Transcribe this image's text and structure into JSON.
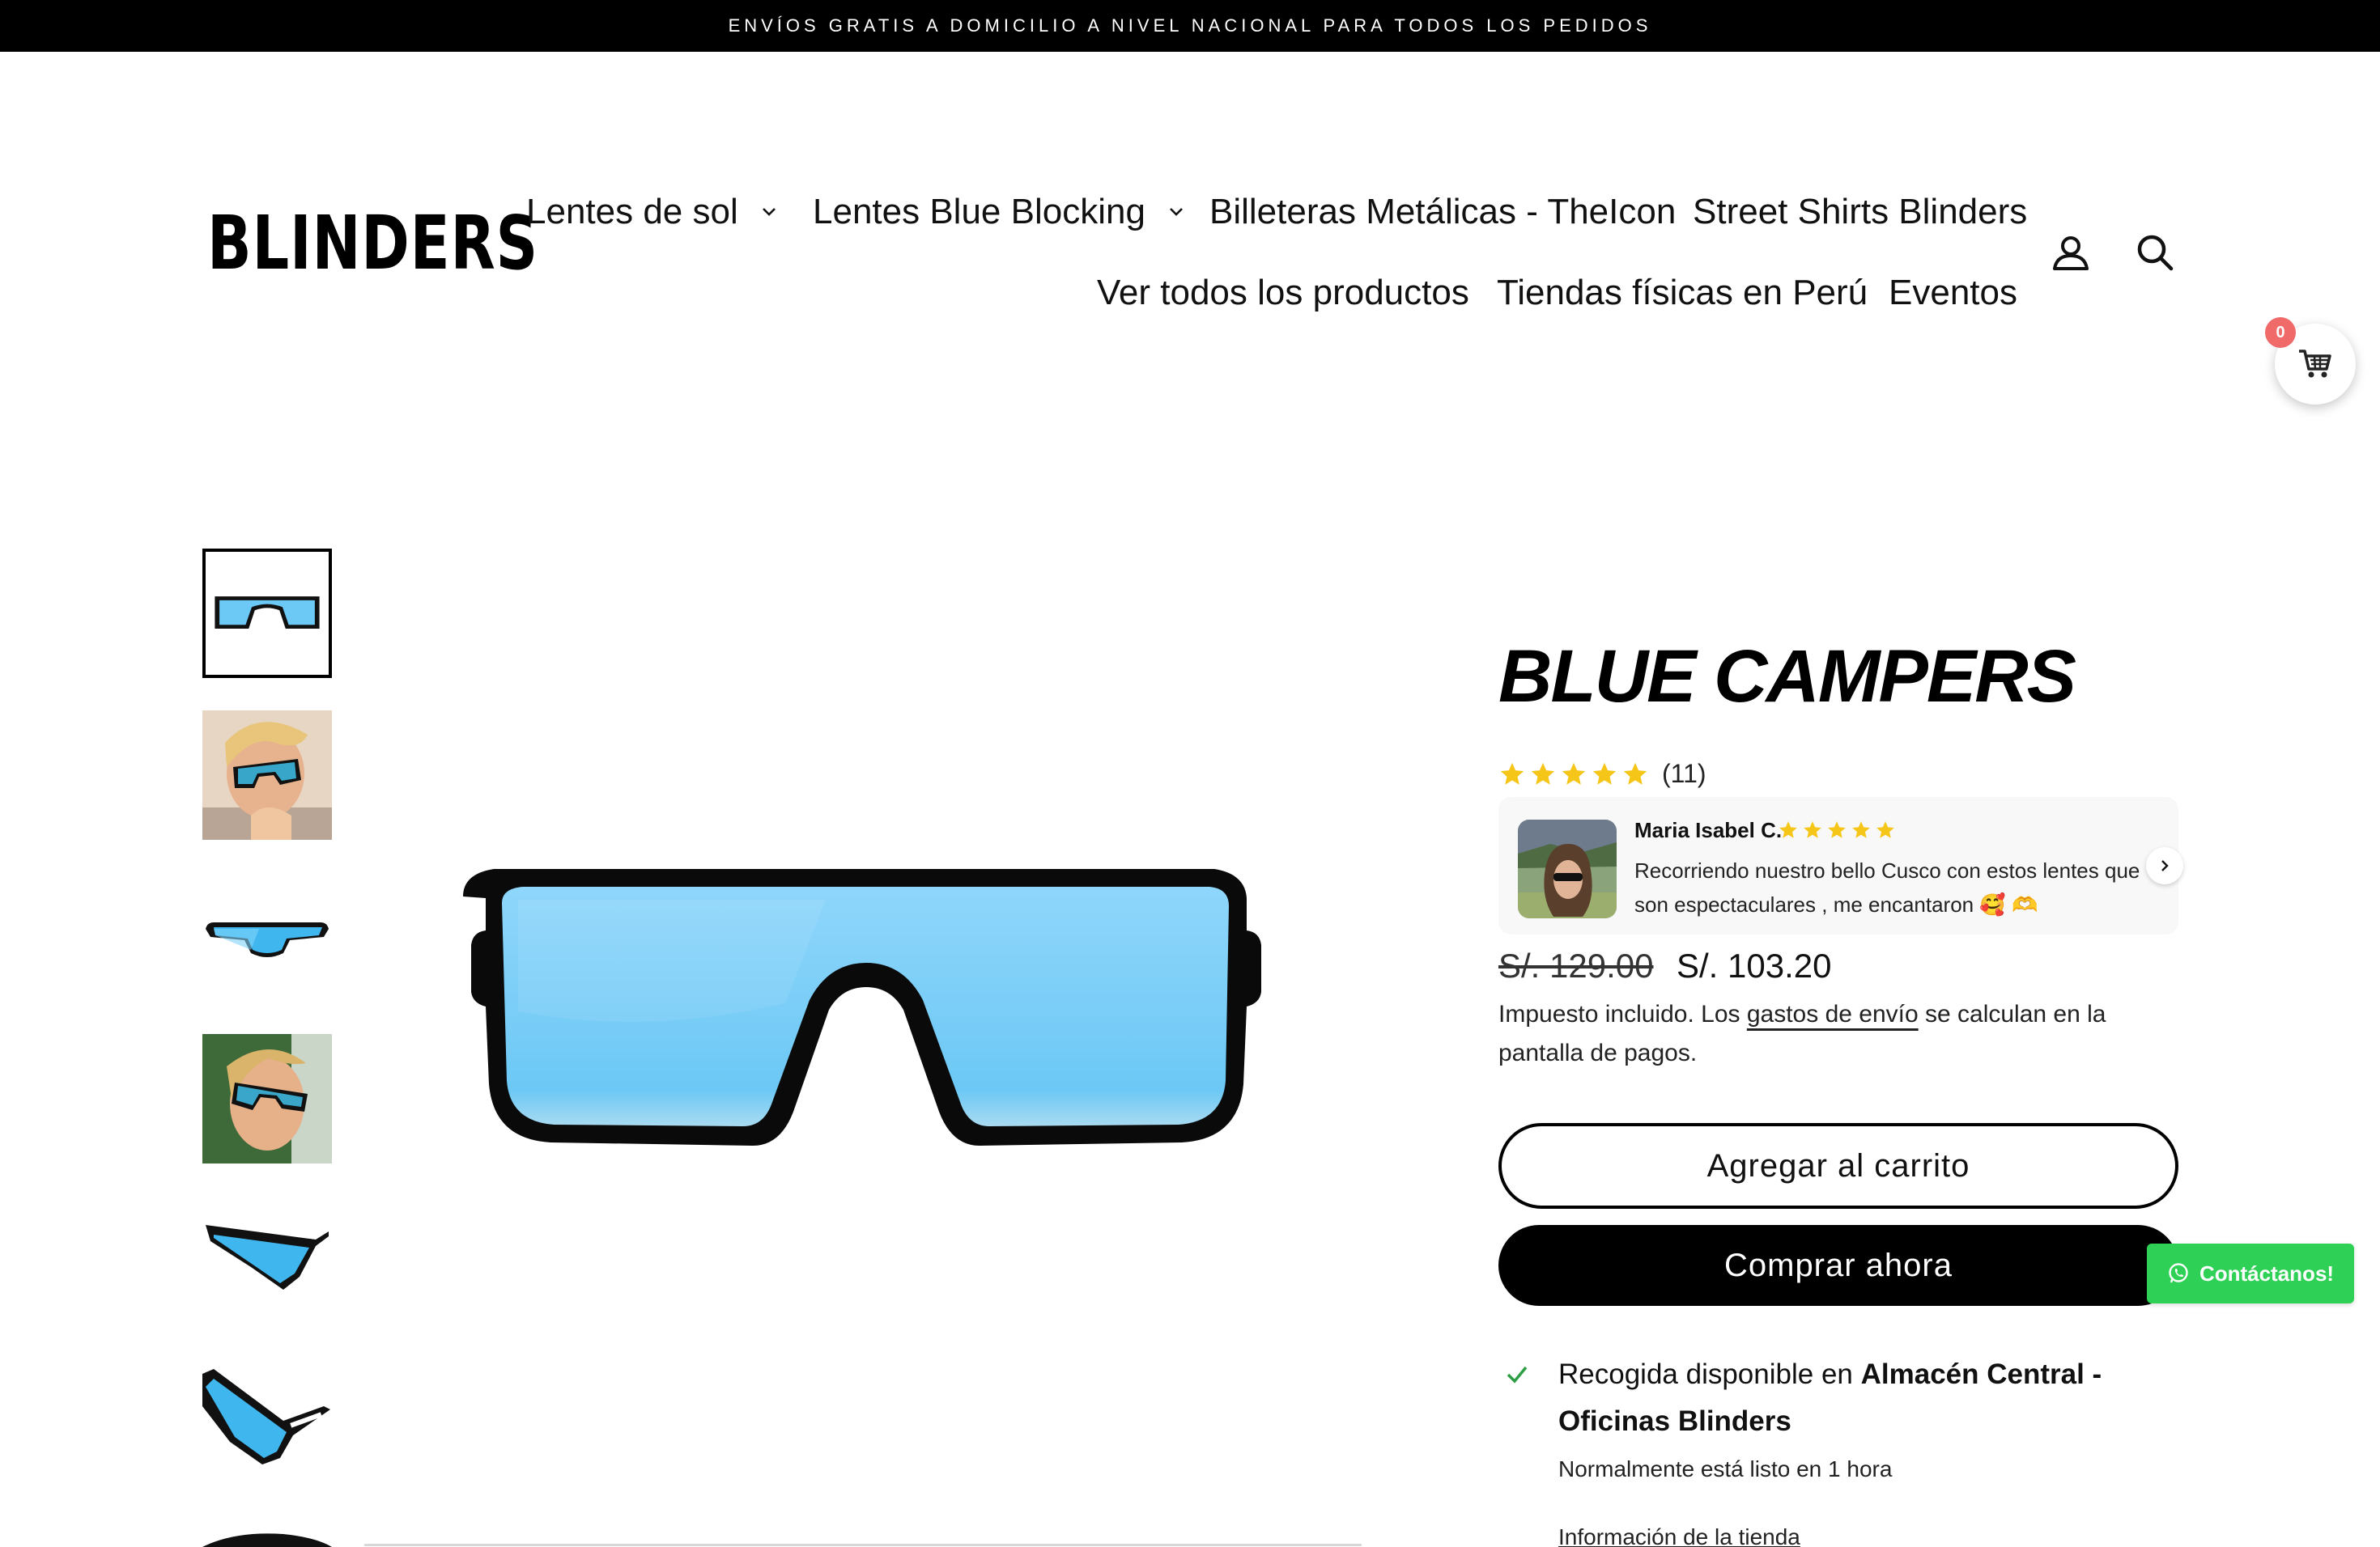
{
  "announcement": {
    "text": "ENVÍOS GRATIS A DOMICILIO A NIVEL NACIONAL PARA TODOS LOS PEDIDOS"
  },
  "header": {
    "logo": "BLINDERS",
    "nav": [
      {
        "label": "Lentes de sol",
        "has_dropdown": true
      },
      {
        "label": "Lentes Blue Blocking",
        "has_dropdown": true
      },
      {
        "label": "Billeteras Metálicas - TheIcon",
        "has_dropdown": false
      },
      {
        "label": "Street Shirts Blinders",
        "has_dropdown": false
      },
      {
        "label": "Ver todos los productos",
        "has_dropdown": false
      },
      {
        "label": "Tiendas físicas en Perú",
        "has_dropdown": false
      },
      {
        "label": "Eventos",
        "has_dropdown": false
      }
    ],
    "icons": [
      "account-icon",
      "search-icon"
    ]
  },
  "floating_cart": {
    "count": "0"
  },
  "gallery": {
    "thumbnails": [
      "glasses-front",
      "model-blonde-1",
      "glasses-front-angle",
      "model-blonde-2",
      "glasses-side-1",
      "glasses-side-2",
      "glasses-partial"
    ],
    "active_index": 0,
    "lens_color": "#6cc8f5"
  },
  "product": {
    "title": "BLUE CAMPERS",
    "rating": 5,
    "rating_count": "(11)",
    "review": {
      "author": "Maria Isabel C.",
      "stars": 5,
      "text": "Recorriendo nuestro bello Cusco con estos lentes que son espectaculares , me encantaron 🥰 🫶"
    },
    "price_compare": "S/. 129.00",
    "price": "S/. 103.20",
    "tax_prefix": "Impuesto incluido. Los ",
    "tax_link": "gastos de envío",
    "tax_suffix": " se calculan en la pantalla de pagos.",
    "add_to_cart": "Agregar al carrito",
    "buy_now": "Comprar ahora",
    "pickup_prefix": "Recogida disponible en ",
    "pickup_location": "Almacén Central - Oficinas Blinders",
    "pickup_time": "Normalmente está listo en 1 hora",
    "store_info": "Información de la tienda"
  },
  "contact": {
    "label": "Contáctanos!"
  },
  "colors": {
    "star": "#f5c518",
    "whatsapp": "#2fd056",
    "badge": "#f06a6a",
    "check": "#2e9e46"
  }
}
